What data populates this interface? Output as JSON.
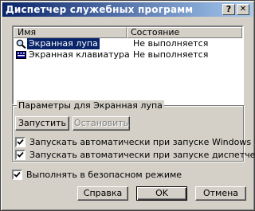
{
  "window": {
    "title": "Диспетчер служебных программ",
    "help_button": "?",
    "close_button": "✕"
  },
  "list": {
    "columns": [
      "Имя",
      "Состояние"
    ],
    "rows": [
      {
        "name": "Экранная лупа",
        "status": "Не выполняется",
        "selected": true,
        "icon": "magnifier-icon"
      },
      {
        "name": "Экранная клавиатура",
        "status": "Не выполняется",
        "selected": false,
        "icon": "keyboard-icon"
      }
    ]
  },
  "group": {
    "title": "Параметры для Экранная лупа",
    "start_label": "Запустить",
    "stop_label": "Остановить",
    "check_windows_label": "Запускать автоматически при запуске Windows",
    "check_dispatcher_label": "Запускать автоматически при запуске диспетчера"
  },
  "safe_mode_label": "Выполнять в безопасном режиме",
  "buttons": {
    "help": "Справка",
    "ok": "OK",
    "cancel": "Отмена"
  },
  "colors": {
    "title_start": "#0a246a",
    "title_end": "#a6caf0",
    "face": "#d4d0c8",
    "selection": "#0a246a"
  }
}
